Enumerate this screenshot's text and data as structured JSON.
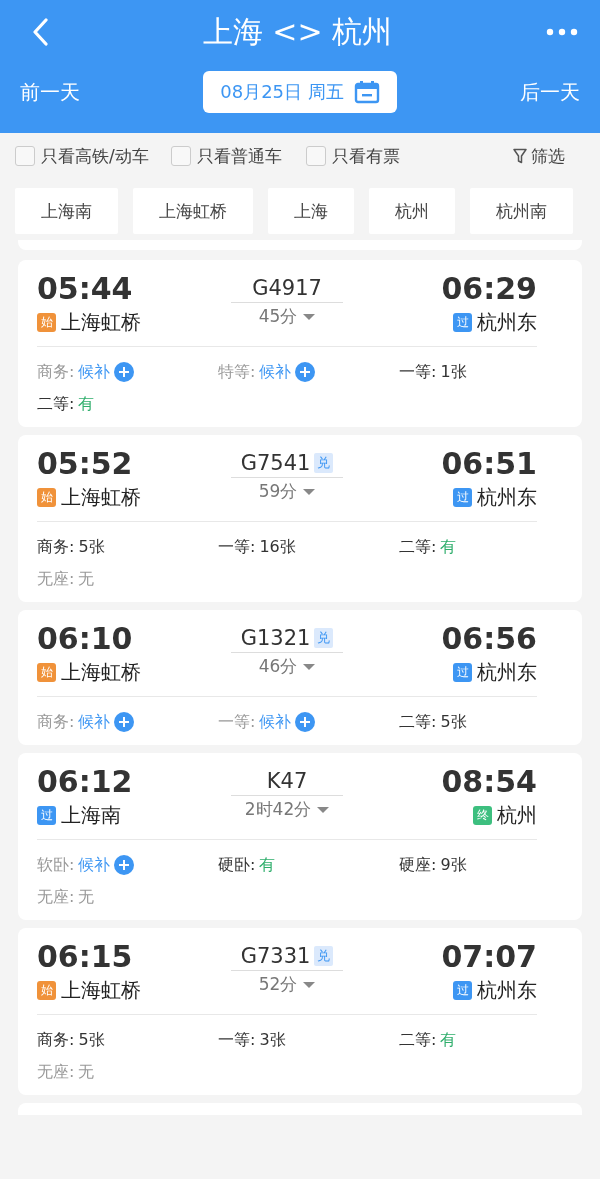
{
  "header": {
    "title": "上海 <> 杭州",
    "prev_day": "前一天",
    "date": "08月25日 周五",
    "next_day": "后一天"
  },
  "filters": [
    {
      "label": "只看高铁/动车",
      "checked": false
    },
    {
      "label": "只看普通车",
      "checked": false
    },
    {
      "label": "只看有票",
      "checked": false
    }
  ],
  "filter_button": "筛选",
  "stations": [
    {
      "label": "上海南",
      "selected": false
    },
    {
      "label": "上海虹桥",
      "selected": false
    },
    {
      "label": "上海",
      "selected": false
    },
    {
      "label": "杭州",
      "selected": false
    },
    {
      "label": "杭州南",
      "selected": false
    }
  ],
  "trains": [
    {
      "depart": "05:44",
      "from": {
        "badge": "始",
        "color": "#f0923a",
        "name": "上海虹桥"
      },
      "number": "G4917",
      "duration": "45分",
      "arrive": "06:29",
      "to": {
        "badge": "过",
        "color": "#3d96f3",
        "name": "杭州东"
      },
      "seats": [
        {
          "label": "商务:",
          "value": "候补",
          "kind": "waitlist"
        },
        {
          "label": "特等:",
          "value": "候补",
          "kind": "waitlist"
        },
        {
          "label": "一等:",
          "value": "1张",
          "kind": "count"
        },
        {
          "label": "二等:",
          "value": "有",
          "kind": "available"
        }
      ]
    },
    {
      "depart": "05:52",
      "from": {
        "badge": "始",
        "color": "#f0923a",
        "name": "上海虹桥"
      },
      "number": "G7541",
      "tag": "兑",
      "duration": "59分",
      "arrive": "06:51",
      "to": {
        "badge": "过",
        "color": "#3d96f3",
        "name": "杭州东"
      },
      "seats": [
        {
          "label": "商务:",
          "value": "5张",
          "kind": "count"
        },
        {
          "label": "一等:",
          "value": "16张",
          "kind": "count"
        },
        {
          "label": "二等:",
          "value": "有",
          "kind": "available"
        },
        {
          "label": "无座:",
          "value": "无",
          "kind": "none"
        }
      ]
    },
    {
      "depart": "06:10",
      "from": {
        "badge": "始",
        "color": "#f0923a",
        "name": "上海虹桥"
      },
      "number": "G1321",
      "tag": "兑",
      "duration": "46分",
      "arrive": "06:56",
      "to": {
        "badge": "过",
        "color": "#3d96f3",
        "name": "杭州东"
      },
      "seats": [
        {
          "label": "商务:",
          "value": "候补",
          "kind": "waitlist"
        },
        {
          "label": "一等:",
          "value": "候补",
          "kind": "waitlist"
        },
        {
          "label": "二等:",
          "value": "5张",
          "kind": "count"
        }
      ]
    },
    {
      "depart": "06:12",
      "from": {
        "badge": "过",
        "color": "#3d96f3",
        "name": "上海南"
      },
      "number": "K47",
      "duration": "2时42分",
      "arrive": "08:54",
      "to": {
        "badge": "终",
        "color": "#3dbf7f",
        "name": "杭州"
      },
      "seats": [
        {
          "label": "软卧:",
          "value": "候补",
          "kind": "waitlist"
        },
        {
          "label": "硬卧:",
          "value": "有",
          "kind": "available"
        },
        {
          "label": "硬座:",
          "value": "9张",
          "kind": "count"
        },
        {
          "label": "无座:",
          "value": "无",
          "kind": "none"
        }
      ]
    },
    {
      "depart": "06:15",
      "from": {
        "badge": "始",
        "color": "#f0923a",
        "name": "上海虹桥"
      },
      "number": "G7331",
      "tag": "兑",
      "duration": "52分",
      "arrive": "07:07",
      "to": {
        "badge": "过",
        "color": "#3d96f3",
        "name": "杭州东"
      },
      "seats": [
        {
          "label": "商务:",
          "value": "5张",
          "kind": "count"
        },
        {
          "label": "一等:",
          "value": "3张",
          "kind": "count"
        },
        {
          "label": "二等:",
          "value": "有",
          "kind": "available"
        },
        {
          "label": "无座:",
          "value": "无",
          "kind": "none"
        }
      ]
    }
  ]
}
